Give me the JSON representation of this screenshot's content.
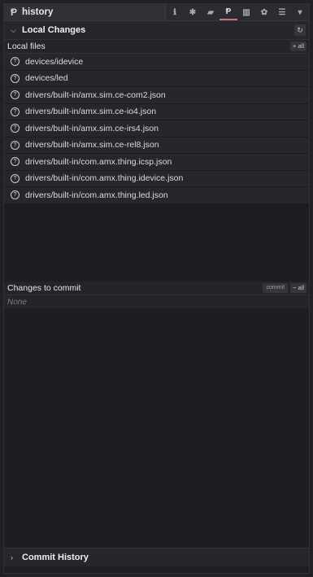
{
  "header": {
    "title": "history",
    "toolbar": [
      {
        "name": "info-icon",
        "glyph": "ℹ",
        "active": false
      },
      {
        "name": "debug-icon",
        "glyph": "✱",
        "active": false
      },
      {
        "name": "book-icon",
        "glyph": "▰",
        "active": false
      },
      {
        "name": "git-branch-icon",
        "glyph": "Ᵽ",
        "active": true
      },
      {
        "name": "chart-icon",
        "glyph": "▥",
        "active": false
      },
      {
        "name": "gear-icon",
        "glyph": "✿",
        "active": false
      },
      {
        "name": "database-icon",
        "glyph": "☰",
        "active": false
      },
      {
        "name": "chevron-down-icon",
        "glyph": "▾",
        "active": false
      }
    ]
  },
  "local_changes": {
    "label": "Local Changes",
    "local_files_label": "Local files",
    "add_all_label": "+ all",
    "files": [
      "devices/idevice",
      "devices/led",
      "drivers/built-in/amx.sim.ce-com2.json",
      "drivers/built-in/amx.sim.ce-io4.json",
      "drivers/built-in/amx.sim.ce-irs4.json",
      "drivers/built-in/amx.sim.ce-rel8.json",
      "drivers/built-in/com.amx.thing.icsp.json",
      "drivers/built-in/com.amx.thing.idevice.json",
      "drivers/built-in/com.amx.thing.led.json"
    ]
  },
  "changes_to_commit": {
    "label": "Changes to commit",
    "commit_label": "commit",
    "remove_all_label": "− all",
    "empty_text": "None"
  },
  "commit_history": {
    "label": "Commit History"
  },
  "colors": {
    "accent": "#d46b79",
    "background": "#1d1f23"
  }
}
